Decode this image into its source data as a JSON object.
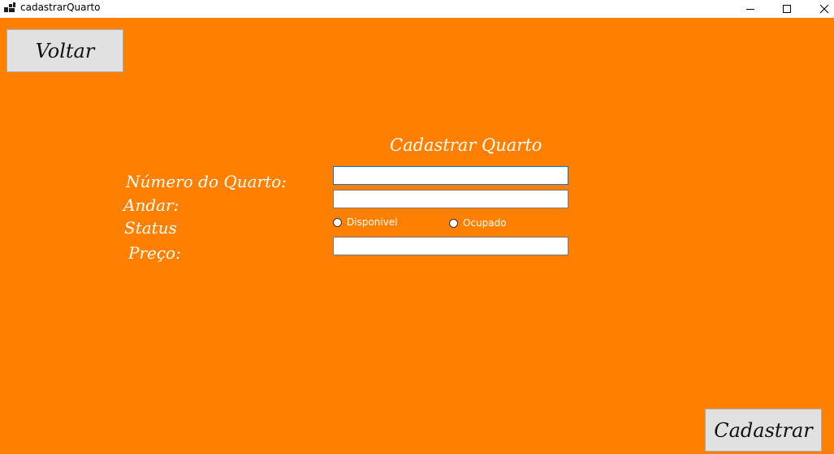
{
  "window": {
    "title": "cadastrarQuarto",
    "background": "#ff8000"
  },
  "buttons": {
    "voltar": "Voltar",
    "cadastrar": "Cadastrar"
  },
  "form": {
    "heading": "Cadastrar Quarto",
    "labels": {
      "numero": "Número do Quarto:",
      "andar": "Andar:",
      "status": "Status",
      "preco": "Preço:"
    },
    "values": {
      "numero": "",
      "andar": "",
      "preco": ""
    },
    "status_options": [
      "Disponivel",
      "Ocupado"
    ]
  }
}
